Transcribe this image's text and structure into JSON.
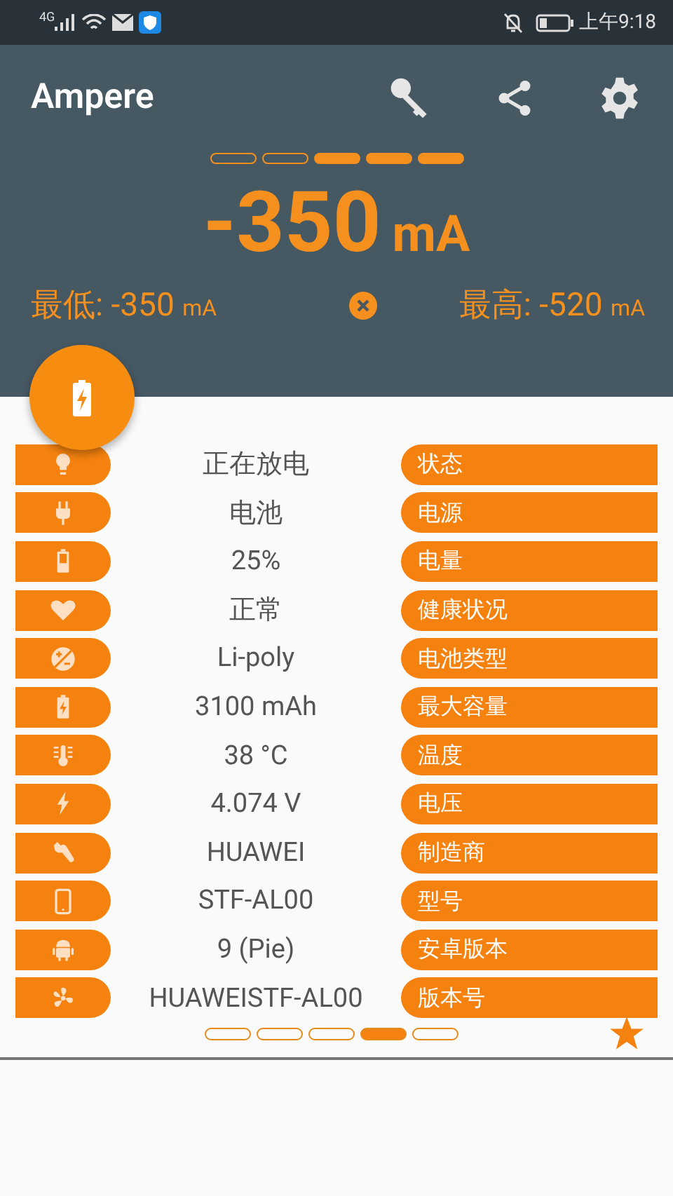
{
  "status_bar": {
    "network": "4G",
    "time": "上午9:18"
  },
  "app_bar": {
    "title": "Ampere"
  },
  "meter": {
    "segments": [
      {
        "on": false
      },
      {
        "on": false
      },
      {
        "on": true
      },
      {
        "on": true
      },
      {
        "on": true
      }
    ],
    "reading": "-350",
    "unit": "mA",
    "min_label": "最低:",
    "min_value": "-350",
    "min_unit": "mA",
    "max_label": "最高:",
    "max_value": "-520",
    "max_unit": "mA"
  },
  "rows": [
    {
      "kind": "bulb",
      "value": "正在放电",
      "label": "状态"
    },
    {
      "kind": "plug",
      "value": "电池",
      "label": "电源"
    },
    {
      "kind": "battery",
      "value": "25%",
      "label": "电量"
    },
    {
      "kind": "heart",
      "value": "正常",
      "label": "健康状况"
    },
    {
      "kind": "plusminus",
      "value": "Li-poly",
      "label": "电池类型"
    },
    {
      "kind": "charge",
      "value": "3100 mAh",
      "label": "最大容量"
    },
    {
      "kind": "thermo",
      "value": "38 °C",
      "label": "温度"
    },
    {
      "kind": "bolt",
      "value": "4.074 V",
      "label": "电压"
    },
    {
      "kind": "wrench",
      "value": "HUAWEI",
      "label": "制造商"
    },
    {
      "kind": "phone",
      "value": "STF-AL00",
      "label": "型号"
    },
    {
      "kind": "android",
      "value": "9 (Pie)",
      "label": "安卓版本"
    },
    {
      "kind": "fan",
      "value": "HUAWEISTF-AL00",
      "label": "版本号"
    }
  ],
  "pager": [
    {
      "selected": false
    },
    {
      "selected": false
    },
    {
      "selected": false
    },
    {
      "selected": true
    },
    {
      "selected": false
    }
  ]
}
